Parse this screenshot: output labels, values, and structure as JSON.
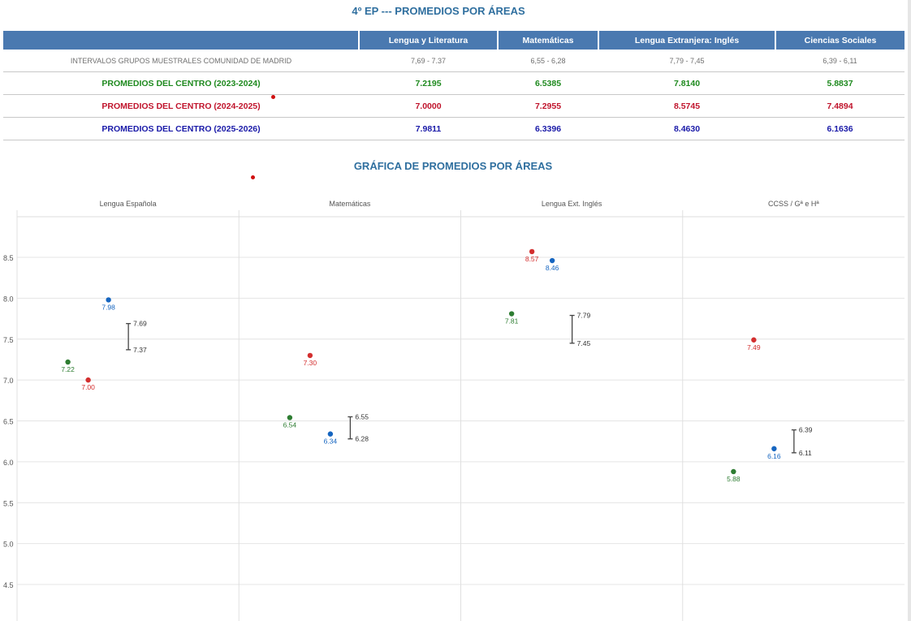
{
  "page_title": "4º EP --- PROMEDIOS POR ÁREAS",
  "table": {
    "headers": [
      "",
      "Lengua y Literatura",
      "Matemáticas",
      "Lengua Extranjera: Inglés",
      "Ciencias Sociales"
    ],
    "interval_row": {
      "label": "INTERVALOS GRUPOS MUESTRALES COMUNIDAD DE MADRID",
      "values": [
        "7,69 - 7.37",
        "6,55 - 6,28",
        "7,79 - 7,45",
        "6,39 - 6,11"
      ]
    },
    "rows": [
      {
        "label": "PROMEDIOS DEL CENTRO (2023-2024)",
        "values": [
          "7.2195",
          "6.5385",
          "7.8140",
          "5.8837"
        ],
        "color": "#1f8a1f"
      },
      {
        "label": "PROMEDIOS DEL CENTRO (2024-2025)",
        "values": [
          "7.0000",
          "7.2955",
          "8.5745",
          "7.4894"
        ],
        "color": "#c0142c"
      },
      {
        "label": "PROMEDIOS DEL CENTRO (2025-2026)",
        "values": [
          "7.9811",
          "6.3396",
          "8.4630",
          "6.1636"
        ],
        "color": "#1a1aa8"
      }
    ]
  },
  "chart_title": "GRÁFICA DE PROMEDIOS POR ÁREAS",
  "chart_data": {
    "type": "scatter",
    "title": "GRÁFICA DE PROMEDIOS POR ÁREAS",
    "categories": [
      "Lengua Española",
      "Matemáticas",
      "Lengua Ext. Inglés",
      "CCSS / Gª e Hª"
    ],
    "ylim": [
      4.25,
      9.0
    ],
    "yticks": [
      "4.5",
      "5.0",
      "5.5",
      "6.0",
      "6.5",
      "7.0",
      "7.5",
      "8.0",
      "8.5"
    ],
    "grid": true,
    "series": [
      {
        "values": [
          7.22,
          6.54,
          7.81,
          5.88
        ],
        "labels": [
          "7.22",
          "6.54",
          "7.81",
          "5.88"
        ],
        "color": "#2e7d32"
      },
      {
        "values": [
          7.0,
          7.3,
          8.57,
          7.49
        ],
        "labels": [
          "7.00",
          "7.30",
          "8.57",
          "7.49"
        ],
        "color": "#d32f2f"
      },
      {
        "values": [
          7.98,
          6.34,
          8.46,
          6.16
        ],
        "labels": [
          "7.98",
          "6.34",
          "8.46",
          "6.16"
        ],
        "color": "#1565c0"
      }
    ],
    "intervals": [
      {
        "high": 7.69,
        "low": 7.37,
        "high_label": "7.69",
        "low_label": "7.37"
      },
      {
        "high": 6.55,
        "low": 6.28,
        "high_label": "6.55",
        "low_label": "6.28"
      },
      {
        "high": 7.79,
        "low": 7.45,
        "high_label": "7.79",
        "low_label": "7.45"
      },
      {
        "high": 6.39,
        "low": 6.11,
        "high_label": "6.39",
        "low_label": "6.11"
      }
    ],
    "interval_color": "#444444"
  },
  "colors": {
    "header_bg": "#4a79b0",
    "title": "#2f6f9f",
    "stray_dot": "#d01010"
  }
}
